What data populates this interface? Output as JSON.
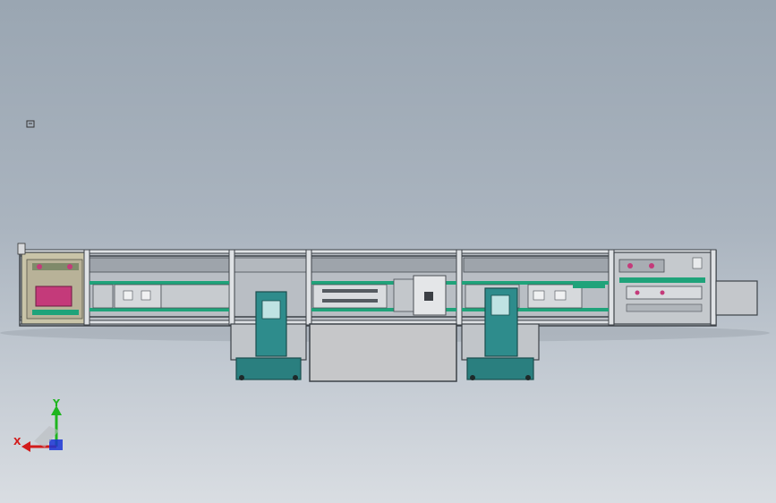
{
  "viewport": {
    "background_top": "#9aa6b2",
    "background_bottom": "#d9dde2"
  },
  "model": {
    "frame_color": "#4a4f55",
    "panel_color": "#c9ccd0",
    "accent_green": "#1fa37a",
    "accent_teal": "#2e8c8c",
    "accent_magenta": "#c43a7a",
    "box_color": "#c6c7c9"
  },
  "triad": {
    "x_label": "X",
    "y_label": "Y",
    "x_color": "#d21b1b",
    "y_color": "#1fb51f",
    "z_color": "#1b35d6"
  },
  "indicator": {
    "icon": "reference-marker-icon"
  }
}
